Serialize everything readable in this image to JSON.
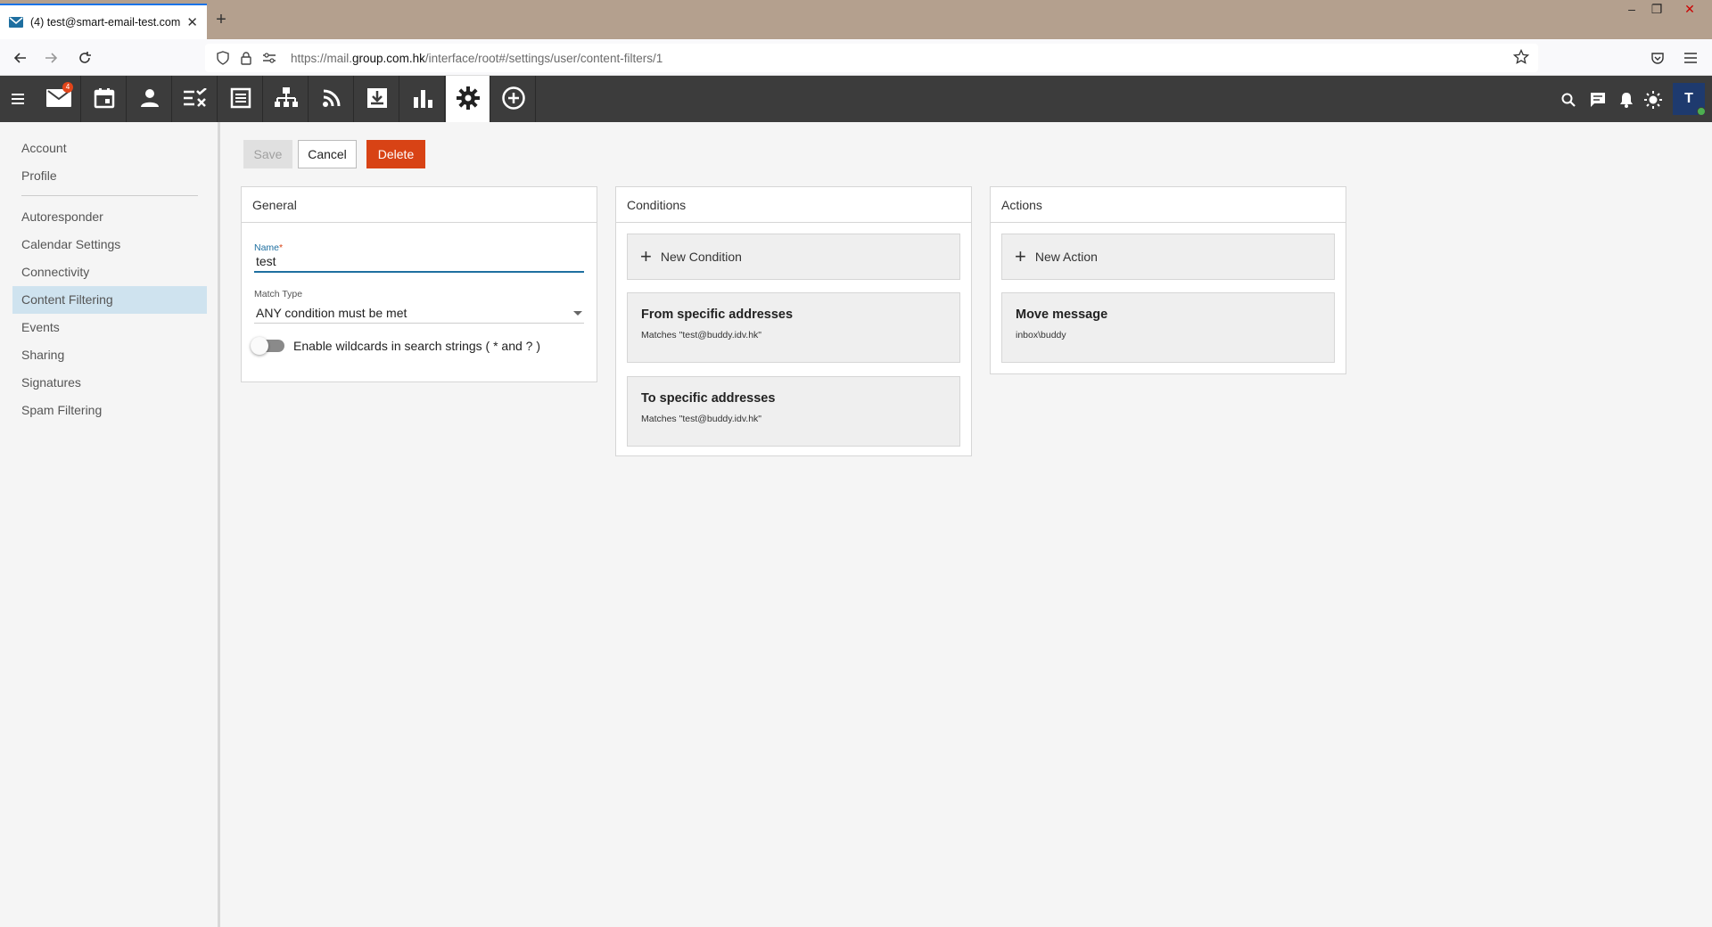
{
  "browser": {
    "tab_title": "(4) test@smart-email-test.com",
    "url_prefix": "https://mail.",
    "url_domain": "group.com.hk",
    "url_path": "/interface/root#/settings/user/content-filters/1"
  },
  "toolbar": {
    "mail_badge": "4",
    "avatar_initial": "T"
  },
  "sidebar": {
    "items": [
      {
        "label": "Account"
      },
      {
        "label": "Profile"
      },
      {
        "label": "Autoresponder"
      },
      {
        "label": "Calendar Settings"
      },
      {
        "label": "Connectivity"
      },
      {
        "label": "Content Filtering"
      },
      {
        "label": "Events"
      },
      {
        "label": "Sharing"
      },
      {
        "label": "Signatures"
      },
      {
        "label": "Spam Filtering"
      }
    ]
  },
  "actions": {
    "save_label": "Save",
    "cancel_label": "Cancel",
    "delete_label": "Delete"
  },
  "general": {
    "title": "General",
    "name_label": "Name",
    "name_required": "*",
    "name_value": "test",
    "match_type_label": "Match Type",
    "match_type_value": "ANY condition must be met",
    "wildcard_label": "Enable wildcards in search strings ( * and ? )"
  },
  "conditions": {
    "title": "Conditions",
    "new_label": "New Condition",
    "items": [
      {
        "title": "From specific addresses",
        "detail": "Matches \"test@buddy.idv.hk\""
      },
      {
        "title": "To specific addresses",
        "detail": "Matches \"test@buddy.idv.hk\""
      }
    ]
  },
  "actions_panel": {
    "title": "Actions",
    "new_label": "New Action",
    "items": [
      {
        "title": "Move message",
        "detail": "inbox\\buddy"
      }
    ]
  },
  "colors": {
    "toolbar_bg": "#3c3c3c",
    "delete_bg": "#d84315",
    "active_sidebar_bg": "#cfe3ef",
    "focus_accent": "#1e6fa0"
  }
}
